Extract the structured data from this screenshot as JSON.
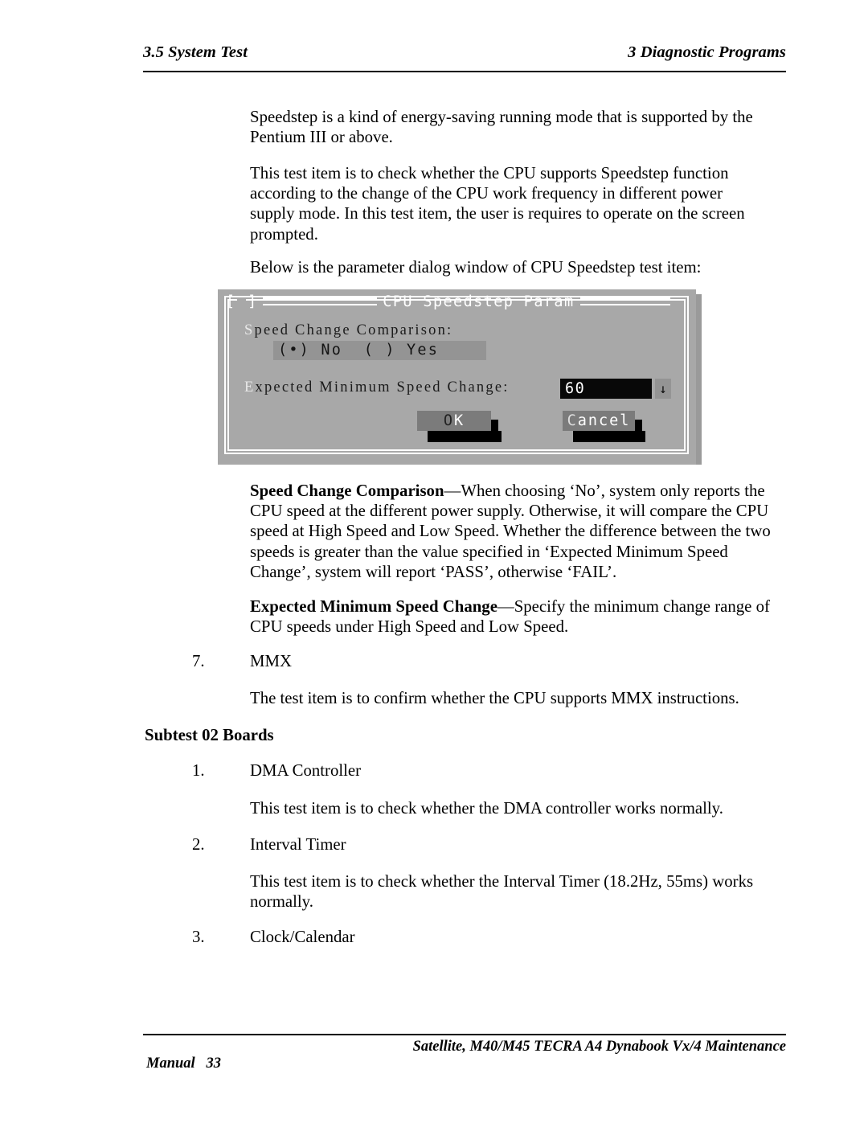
{
  "header": {
    "left": "3.5 System Test",
    "right": "3  Diagnostic Programs"
  },
  "paragraphs": {
    "p1": "Speedstep is a kind of energy-saving running mode that is supported by the Pentium III or above.",
    "p2": "This test item is to check whether the CPU supports Speedstep function according to the change of the CPU work frequency in different power supply mode. In this test item, the user is requires to operate on the screen prompted.",
    "p3": "Below is the parameter dialog window of CPU Speedstep test item:",
    "p4_lead": "Speed Change Comparison",
    "p4_rest": "—When choosing ‘No’, system only reports the CPU speed at the different power supply. Otherwise, it will compare the CPU speed at High Speed and Low Speed. Whether the difference between the two speeds is greater than the value specified in ‘Expected Minimum Speed Change’, system will report ‘PASS’, otherwise ‘FAIL’.",
    "p5_lead": "Expected Minimum Speed Change",
    "p5_rest": "—Specify the minimum change range of CPU speeds under High Speed and Low Speed.",
    "mmx_num": "7.",
    "mmx_label": "MMX",
    "mmx_body": "The test item is to confirm whether the CPU supports MMX instructions."
  },
  "subtest": {
    "heading": "Subtest 02 Boards",
    "items": [
      {
        "num": "1.",
        "label": "DMA Controller",
        "body": "This test item is to check whether the DMA controller works normally."
      },
      {
        "num": "2.",
        "label": "Interval Timer",
        "body": "This test item is to check whether the Interval Timer (18.2Hz, 55ms) works normally."
      },
      {
        "num": "3.",
        "label": "Clock/Calendar",
        "body": ""
      }
    ]
  },
  "dialog": {
    "title": "CPU Speedstep Param",
    "close_box_left": "[",
    "close_box_right": "]",
    "field1": {
      "hotkey": "S",
      "label_rest": "peed Change Comparison:",
      "options_text": "(•) No  ( ) Yes",
      "selected": "No",
      "options": [
        "No",
        "Yes"
      ]
    },
    "field2": {
      "hotkey": "E",
      "label_rest": "xpected Minimum Speed Change:",
      "value": "60",
      "dropdown_icon": "↓"
    },
    "buttons": {
      "ok_hot": "O",
      "ok_rest": "K",
      "cancel_hot": "C",
      "cancel_rest": "ancel"
    },
    "colors": {
      "background": "#a8a8a8",
      "border": "#ffffff",
      "highlight": "#949494",
      "input_bg": "#080808",
      "button_bg": "#7b7b7b",
      "shadow": "#000000"
    }
  },
  "footer": {
    "product": "Satellite, M40/M45 TECRA A4 Dynabook Vx/4 Maintenance",
    "manual": "Manual   33"
  }
}
